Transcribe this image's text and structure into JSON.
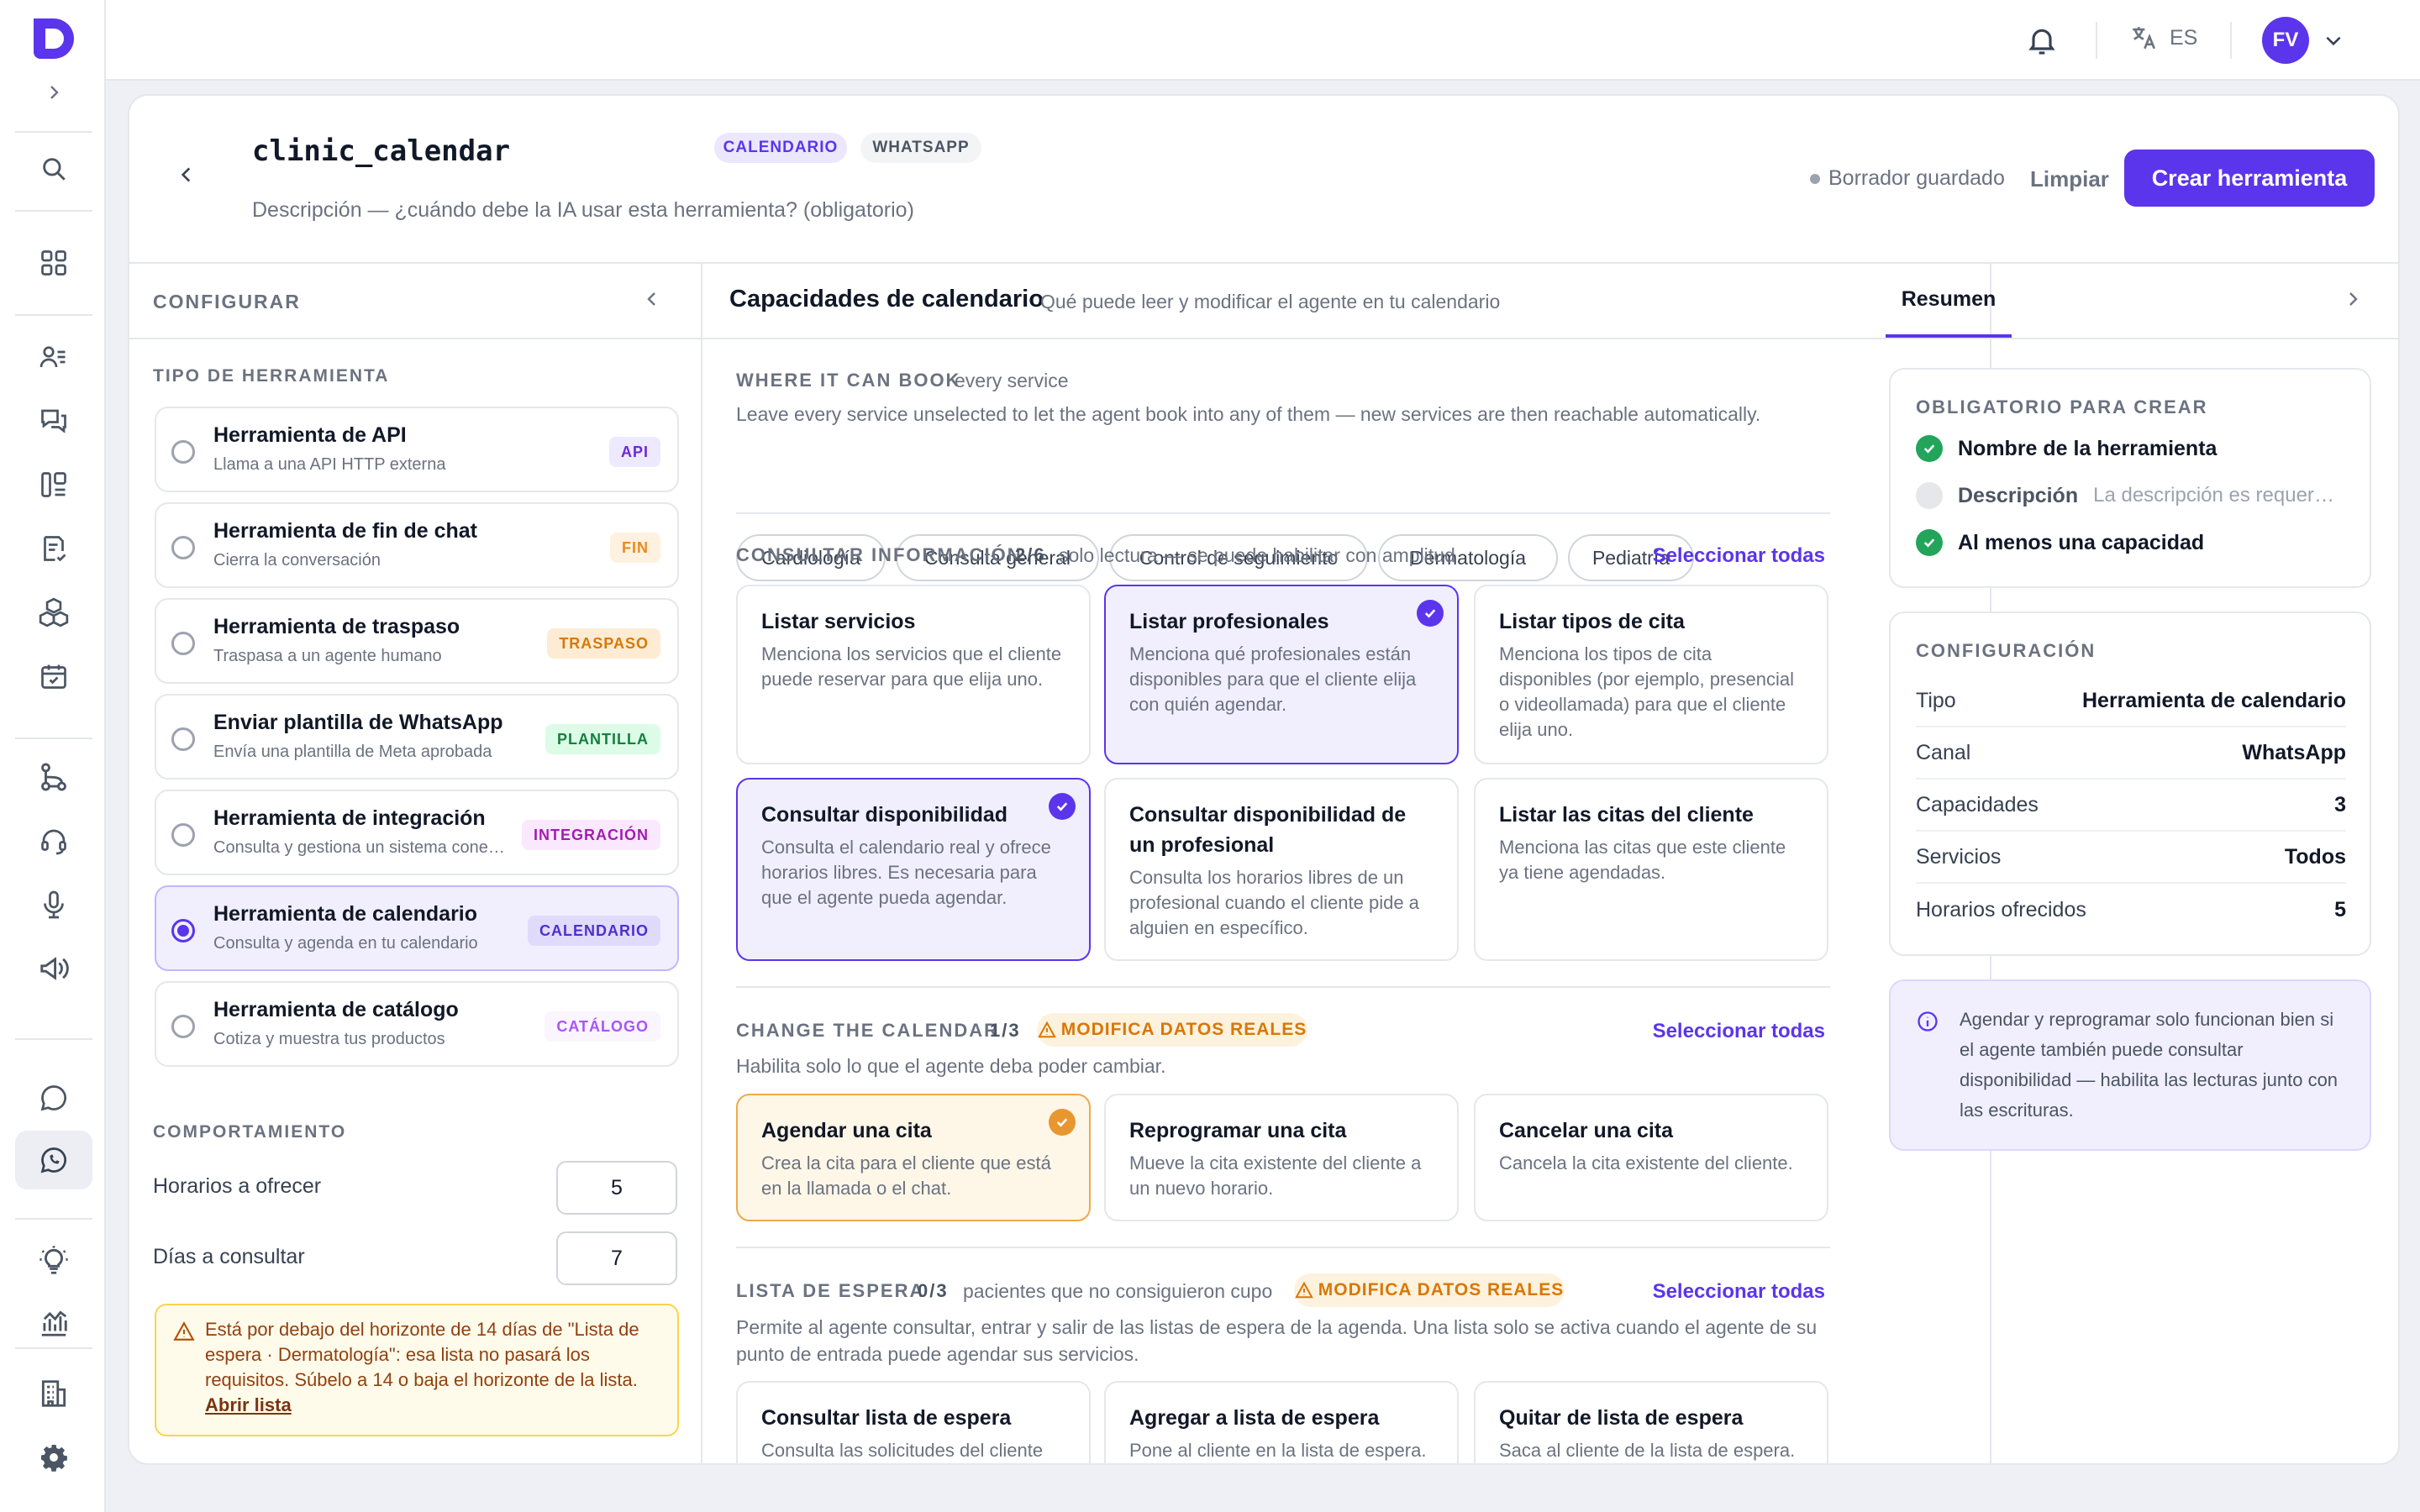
{
  "topbar": {
    "lang": "ES",
    "avatar": "FV"
  },
  "sidebar": {
    "icons": [
      "expand-icon",
      "search-icon",
      "grid-icon",
      "contacts-icon",
      "conversations-icon",
      "pipeline-icon",
      "tasks-icon",
      "packages-icon",
      "calendar-icon",
      "flows-icon",
      "support-icon",
      "microphone-icon",
      "campaigns-icon",
      "chat-icon",
      "whatsapp-icon",
      "ideas-icon",
      "analytics-icon",
      "building-icon",
      "settings-icon"
    ]
  },
  "header": {
    "title": "clinic_calendar",
    "tags": [
      "CALENDARIO",
      "WHATSAPP"
    ],
    "description_placeholder": "Descripción — ¿cuándo debe la IA usar esta herramienta? (obligatorio)",
    "status": "Borrador guardado",
    "clear_label": "Limpiar",
    "create_label": "Crear herramienta"
  },
  "left": {
    "title": "CONFIGURAR",
    "tool_type_title": "TIPO DE HERRAMIENTA",
    "tools": [
      {
        "title": "Herramienta de API",
        "subtitle": "Llama a una API HTTP externa",
        "tag": "API"
      },
      {
        "title": "Herramienta de fin de chat",
        "subtitle": "Cierra la conversación",
        "tag": "FIN"
      },
      {
        "title": "Herramienta de traspaso",
        "subtitle": "Traspasa a un agente humano",
        "tag": "TRASPASO"
      },
      {
        "title": "Enviar plantilla de WhatsApp",
        "subtitle": "Envía una plantilla de Meta aprobada",
        "tag": "PLANTILLA"
      },
      {
        "title": "Herramienta de integración",
        "subtitle": "Consulta y gestiona un sistema conectado",
        "tag": "INTEGRACIÓN"
      },
      {
        "title": "Herramienta de calendario",
        "subtitle": "Consulta y agenda en tu calendario",
        "tag": "CALENDARIO",
        "selected": true
      },
      {
        "title": "Herramienta de catálogo",
        "subtitle": "Cotiza y muestra tus productos",
        "tag": "CATÁLOGO"
      }
    ],
    "behavior_title": "COMPORTAMIENTO",
    "slots_label": "Horarios a ofrecer",
    "slots_value": "5",
    "days_label": "Días a consultar",
    "days_value": "7",
    "warning_text": "Está por debajo del horizonte de 14 días de \"Lista de espera · Dermatología\": esa lista no pasará los requisitos. Súbelo a 14 o baja el horizonte de la lista.",
    "warning_link": "Abrir lista"
  },
  "center": {
    "title": "Capacidades de calendario",
    "subtitle": "Qué puede leer y modificar el agente en tu calendario",
    "book": {
      "title": "WHERE IT CAN BOOK",
      "scope": "every service",
      "hint": "Leave every service unselected to let the agent book into any of them — new services are then reachable automatically.",
      "services": [
        "Cardiología",
        "Consulta general",
        "Control de seguimiento",
        "Dermatología",
        "Pediatría"
      ]
    },
    "read": {
      "title": "CONSULTAR INFORMACIÓN",
      "count": "2/6",
      "note": "solo lectura — se puede habilitar con amplitud",
      "select_all": "Seleccionar todas",
      "caps": [
        {
          "title": "Listar servicios",
          "desc": "Menciona los servicios que el cliente puede reservar para que elija uno."
        },
        {
          "title": "Listar profesionales",
          "desc": "Menciona qué profesionales están disponibles para que el cliente elija con quién agendar.",
          "selected": true
        },
        {
          "title": "Listar tipos de cita",
          "desc": "Menciona los tipos de cita disponibles (por ejemplo, presencial o videollamada) para que el cliente elija uno."
        },
        {
          "title": "Consultar disponibilidad",
          "desc": "Consulta el calendario real y ofrece horarios libres. Es necesaria para que el agente pueda agendar.",
          "selected": true
        },
        {
          "title": "Consultar disponibilidad de un profesional",
          "desc": "Consulta los horarios libres de un profesional cuando el cliente pide a alguien en específico."
        },
        {
          "title": "Listar las citas del cliente",
          "desc": "Menciona las citas que este cliente ya tiene agendadas."
        }
      ]
    },
    "change": {
      "title": "CHANGE THE CALENDAR",
      "count": "1/3",
      "badge": "MODIFICA DATOS REALES",
      "select_all": "Seleccionar todas",
      "hint": "Habilita solo lo que el agente deba poder cambiar.",
      "caps": [
        {
          "title": "Agendar una cita",
          "desc": "Crea la cita para el cliente que está en la llamada o el chat.",
          "selected": true
        },
        {
          "title": "Reprogramar una cita",
          "desc": "Mueve la cita existente del cliente a un nuevo horario."
        },
        {
          "title": "Cancelar una cita",
          "desc": "Cancela la cita existente del cliente."
        }
      ]
    },
    "waitlist": {
      "title": "LISTA DE ESPERA",
      "count": "0/3",
      "note": "pacientes que no consiguieron cupo",
      "badge": "MODIFICA DATOS REALES",
      "select_all": "Seleccionar todas",
      "hint": "Permite al agente consultar, entrar y salir de las listas de espera de la agenda. Una lista solo se activa cuando el agente de su punto de entrada puede agendar sus servicios.",
      "caps": [
        {
          "title": "Consultar lista de espera",
          "desc": "Consulta las solicitudes del cliente en la lista de espera."
        },
        {
          "title": "Agregar a lista de espera",
          "desc": "Pone al cliente en la lista de espera."
        },
        {
          "title": "Quitar de lista de espera",
          "desc": "Saca al cliente de la lista de espera."
        }
      ]
    }
  },
  "right": {
    "tab": "Resumen",
    "required_title": "OBLIGATORIO PARA CREAR",
    "required": [
      {
        "label": "Nombre de la herramienta",
        "done": true
      },
      {
        "label": "Descripción",
        "note": "La descripción es requerida",
        "done": false
      },
      {
        "label": "Al menos una capacidad",
        "done": true
      }
    ],
    "config_title": "CONFIGURACIÓN",
    "config": [
      {
        "label": "Tipo",
        "value": "Herramienta de calendario"
      },
      {
        "label": "Canal",
        "value": "WhatsApp"
      },
      {
        "label": "Capacidades",
        "value": "3"
      },
      {
        "label": "Servicios",
        "value": "Todos"
      },
      {
        "label": "Horarios ofrecidos",
        "value": "5"
      }
    ],
    "info": "Agendar y reprogramar solo funcionan bien si el agente también puede consultar disponibilidad — habilita las lecturas junto con las escrituras."
  },
  "colors": {
    "accent": "#5b35ec",
    "success": "#22a55b",
    "warning": "#d97706"
  }
}
